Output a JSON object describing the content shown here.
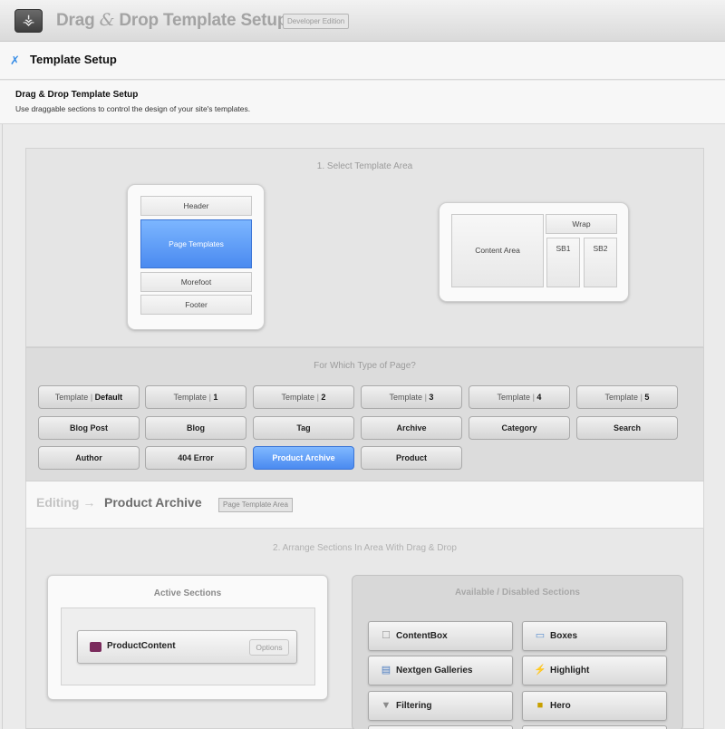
{
  "app": {
    "logo_glyph": "⚶",
    "title_part1": "Drag ",
    "title_amp": "&",
    "title_part2": " Drop Template Setup",
    "edition": "Developer Edition"
  },
  "page_header": {
    "icon": "wrench-icon",
    "icon_glyph": "✗",
    "title": "Template Setup"
  },
  "intro": {
    "heading": "Drag & Drop Template Setup",
    "description": "Use draggable sections to control the design of your site's templates."
  },
  "select_area": {
    "title": "1. Select Template Area",
    "layout_slots": {
      "header": "Header",
      "page_templates": "Page Templates",
      "morefoot": "Morefoot",
      "footer": "Footer"
    },
    "wrap_slots": {
      "content_area": "Content Area",
      "wrap": "Wrap",
      "sb1": "SB1",
      "sb2": "SB2"
    },
    "selected": "Page Templates"
  },
  "page_types": {
    "title": "For Which Type of Page?",
    "template_prefix": "Template",
    "template_sep": " | ",
    "templates": [
      "Default",
      "1",
      "2",
      "3",
      "4",
      "5"
    ],
    "row2": [
      "Blog Post",
      "Blog",
      "Tag",
      "Archive",
      "Category",
      "Search"
    ],
    "row3": [
      "Author",
      "404 Error",
      "Product Archive",
      "Product"
    ],
    "selected": "Product Archive"
  },
  "editing": {
    "prefix": "Editing →",
    "name": "Product Archive",
    "badge": "Page Template Area"
  },
  "arrange": {
    "title": "2. Arrange Sections In Area With Drag & Drop",
    "active_title": "Active Sections",
    "active_items": [
      {
        "label": "ProductContent",
        "options": "Options",
        "icon": "product-content-icon"
      }
    ],
    "available_title": "Available / Disabled Sections",
    "available_items": [
      {
        "label": "ContentBox",
        "icon": "content-box-icon",
        "glyph": "☐",
        "color": "#9a9a9a"
      },
      {
        "label": "Boxes",
        "icon": "boxes-icon",
        "glyph": "▭",
        "color": "#5b8fcf"
      },
      {
        "label": "Nextgen Galleries",
        "icon": "gallery-icon",
        "glyph": "▤",
        "color": "#4a7bc0"
      },
      {
        "label": "Highlight",
        "icon": "lightning-icon",
        "glyph": "⚡",
        "color": "#e6b800"
      },
      {
        "label": "Filtering",
        "icon": "filter-icon",
        "glyph": "▼",
        "color": "#8a8a8a"
      },
      {
        "label": "Hero",
        "icon": "hero-icon",
        "glyph": "■",
        "color": "#c8a000"
      }
    ]
  },
  "colors": {
    "accent_blue": "#4a8af0",
    "panel_gray": "#e5e5e5"
  }
}
